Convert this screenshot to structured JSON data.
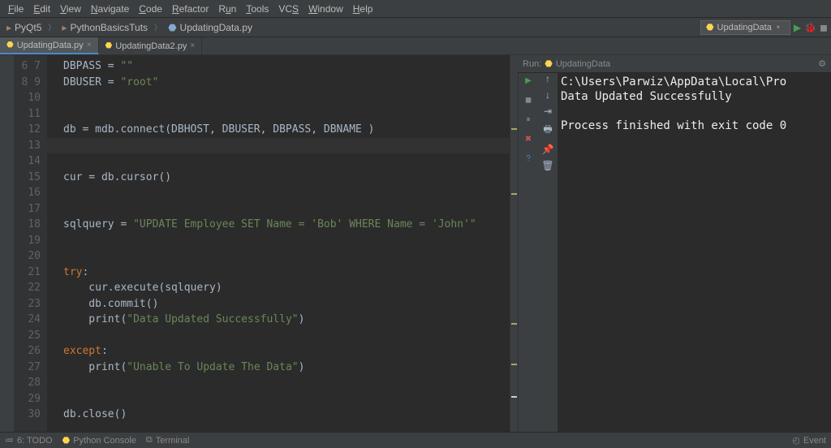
{
  "menu": {
    "items": [
      "File",
      "Edit",
      "View",
      "Navigate",
      "Code",
      "Refactor",
      "Run",
      "Tools",
      "VCS",
      "Window",
      "Help"
    ]
  },
  "breadcrumbs": {
    "items": [
      {
        "icon": "folder",
        "label": "PyQt5"
      },
      {
        "icon": "folder",
        "label": "PythonBasicsTuts"
      },
      {
        "icon": "py",
        "label": "UpdatingData.py"
      }
    ]
  },
  "run_config": {
    "label": "UpdatingData"
  },
  "tabs": [
    {
      "label": "UpdatingData.py",
      "active": true
    },
    {
      "label": "UpdatingData2.py",
      "active": false
    }
  ],
  "lines_start": 6,
  "lines_end": 30,
  "code": {
    "l6": {
      "a": "DBPASS = ",
      "s": "\"\""
    },
    "l7": {
      "a": "DBUSER = ",
      "s": "\"root\""
    },
    "l10": {
      "a": "db = mdb.connect(DBHOST, DBUSER, DBPASS, DBNAME )"
    },
    "l13": {
      "a": "cur = db.cursor()"
    },
    "l16": {
      "a": "sqlquery = ",
      "s": "\"UPDATE Employee SET Name = 'Bob' WHERE Name = 'John'\""
    },
    "l19": {
      "k": "try",
      "a": ":"
    },
    "l20": {
      "a": "    cur.execute(sqlquery)"
    },
    "l21": {
      "a": "    db.commit()"
    },
    "l22": {
      "a": "    print(",
      "s": "\"Data Updated Successfully\"",
      "c": ")"
    },
    "l24": {
      "k": "except",
      "a": ":"
    },
    "l25": {
      "a": "    print(",
      "s": "\"Unable To Update The Data\"",
      "c": ")"
    },
    "l28": {
      "a": "db.close()"
    }
  },
  "run_panel": {
    "title": "Run:",
    "name": "UpdatingData"
  },
  "console": {
    "line1": "C:\\Users\\Parwiz\\AppData\\Local\\Pro",
    "line2": "Data Updated Successfully",
    "line3": "",
    "line4": "Process finished with exit code 0"
  },
  "status": {
    "todo": "6: TODO",
    "pyconsole": "Python Console",
    "terminal": "Terminal",
    "eventlog": "Event"
  }
}
